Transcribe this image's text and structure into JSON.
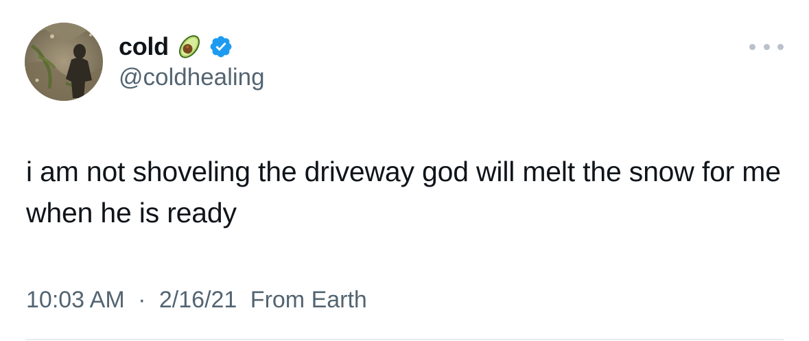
{
  "author": {
    "display_name": "cold",
    "name_emoji": "avocado-emoji",
    "verified_icon": "verified-badge-icon",
    "handle": "@coldhealing"
  },
  "tweet": {
    "text": "i am not shoveling the driveway god will melt the snow for me when he is ready"
  },
  "meta": {
    "time": "10:03 AM",
    "separator": "·",
    "date": "2/16/21",
    "source": "From Earth"
  },
  "menu": {
    "icon": "more-options-icon"
  },
  "colors": {
    "text_primary": "#0f1419",
    "text_secondary": "#536471",
    "verified_blue": "#1d9bf0",
    "divider": "#e6ecf0"
  }
}
